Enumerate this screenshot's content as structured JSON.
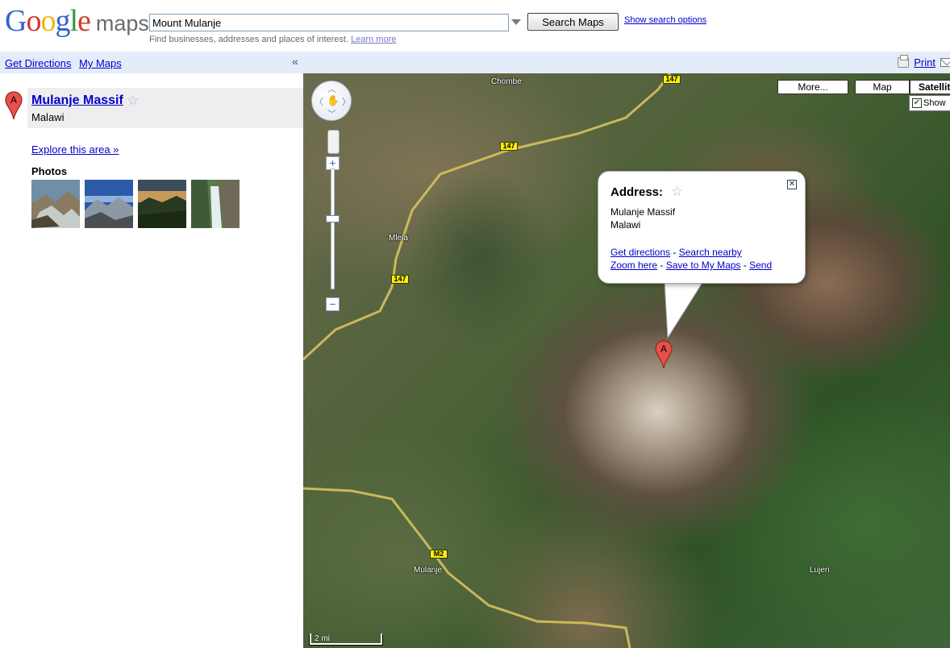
{
  "header": {
    "logo": {
      "g1": "G",
      "o1": "o",
      "o2": "o",
      "g2": "g",
      "l": "l",
      "e": "e",
      "maps": "maps",
      "colors": {
        "blue": "#3366cc",
        "red": "#d13a2b",
        "yellow": "#f2b50f",
        "green": "#2e9b3c"
      }
    },
    "search": {
      "value": "Mount Mulanje",
      "button_label": "Search Maps",
      "options_link": "Show search options",
      "hint_text": "Find businesses, addresses and places of interest.",
      "hint_link": "Learn more"
    }
  },
  "subbar": {
    "get_directions": "Get Directions",
    "my_maps": "My Maps",
    "collapse": "«",
    "print": "Print"
  },
  "sidebar": {
    "result": {
      "marker_letter": "A",
      "title": "Mulanje Massif",
      "country": "Malawi"
    },
    "explore": "Explore this area »",
    "photos_label": "Photos",
    "photos": [
      {
        "name": "photo-1",
        "colors": [
          "#5c7a8f",
          "#c4c9c7"
        ]
      },
      {
        "name": "photo-2",
        "colors": [
          "#2a5aa8",
          "#8d98a3"
        ]
      },
      {
        "name": "photo-3",
        "colors": [
          "#c79a5a",
          "#1c2a14"
        ]
      },
      {
        "name": "photo-4",
        "colors": [
          "#5c7a4c",
          "#e5eef0"
        ]
      }
    ]
  },
  "map": {
    "map_types": {
      "more": "More...",
      "map": "Map",
      "satellite": "Satellit"
    },
    "show_labels": "Show",
    "place_labels": {
      "chombe": "Chombe",
      "mlela": "Mlela",
      "mulanje": "Mulanje",
      "lujeri": "Lujeri"
    },
    "road_shields": {
      "r147": "147",
      "m2": "M2"
    },
    "scale": "2 mi",
    "infowindow": {
      "title": "Address:",
      "line1": "Mulanje Massif",
      "line2": "Malawi",
      "get_directions": "Get directions",
      "search_nearby": "Search nearby",
      "zoom_here": "Zoom here",
      "save_to_my_maps": "Save to My Maps",
      "send": "Send",
      "separator": "-"
    },
    "marker_letter": "A",
    "colors": {
      "road": "#d6c25c",
      "marker": "#e8504a",
      "infowindow_star": "#9bb8e6"
    }
  }
}
